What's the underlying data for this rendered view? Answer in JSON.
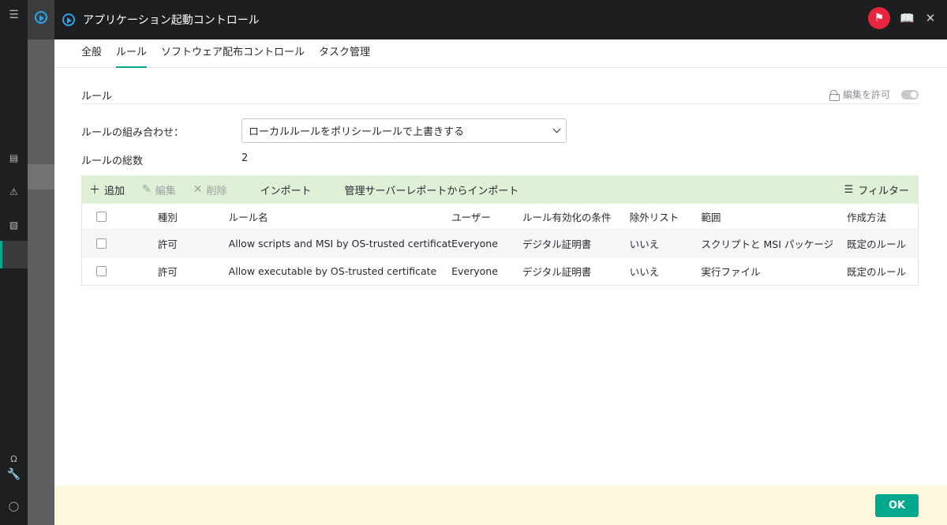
{
  "nav": {
    "icons": [
      "menu-icon",
      "layout-icon",
      "warning-icon",
      "hierarchy-icon",
      "omega-icon",
      "wrench-icon",
      "user-icon"
    ]
  },
  "dialog": {
    "title": "アプリケーション起動コントロール",
    "tabs": [
      {
        "label": "全般",
        "active": false
      },
      {
        "label": "ルール",
        "active": true
      },
      {
        "label": "ソフトウェア配布コントロール",
        "active": false
      },
      {
        "label": "タスク管理",
        "active": false
      }
    ],
    "section_title": "ルール",
    "permission_label": "編集を許可",
    "combo_label": "ルールの組み合わせ：",
    "combo_value": "ローカルルールをポリシールールで上書きする",
    "total_label": "ルールの総数",
    "total_value": "2",
    "toolbar": {
      "add": "追加",
      "edit": "編集",
      "delete": "削除",
      "import": "インポート",
      "import_report": "管理サーバーレポートからインポート",
      "filter": "フィルター"
    },
    "table": {
      "headers": [
        "種別",
        "ルール名",
        "ユーザー",
        "ルール有効化の条件",
        "除外リスト",
        "範囲",
        "作成方法"
      ],
      "rows": [
        [
          "許可",
          "Allow scripts and MSI by OS-trusted certificate",
          "Everyone",
          "デジタル証明書",
          "いいえ",
          "スクリプトと MSI パッケージ",
          "既定のルール"
        ],
        [
          "許可",
          "Allow executable by OS-trusted certificate",
          "Everyone",
          "デジタル証明書",
          "いいえ",
          "実行ファイル",
          "既定のルール"
        ]
      ]
    },
    "ok_label": "OK"
  },
  "colors": {
    "accent": "#00a88e",
    "toolbar_bg": "#dff0d6",
    "footer_bg": "#fdf8dc",
    "flag": "#e8253f",
    "title_icon": "#2da4e8"
  }
}
